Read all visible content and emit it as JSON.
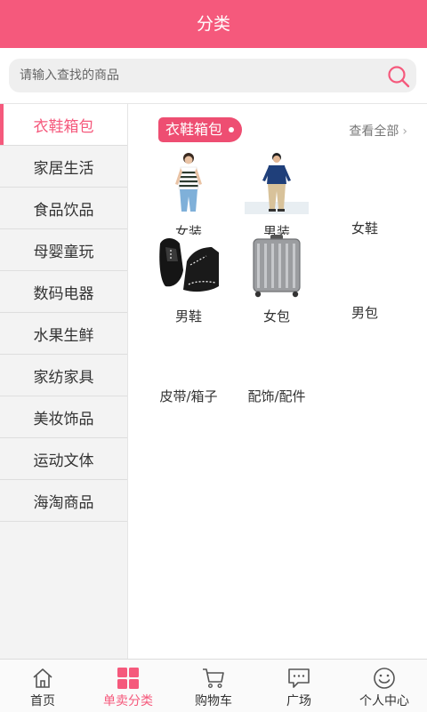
{
  "header": {
    "title": "分类"
  },
  "search": {
    "placeholder": "请输入查找的商品"
  },
  "sidebar": {
    "items": [
      {
        "label": "衣鞋箱包",
        "active": true
      },
      {
        "label": "家居生活"
      },
      {
        "label": "食品饮品"
      },
      {
        "label": "母婴童玩"
      },
      {
        "label": "数码电器"
      },
      {
        "label": "水果生鲜"
      },
      {
        "label": "家纺家具"
      },
      {
        "label": "美妆饰品"
      },
      {
        "label": "运动文体"
      },
      {
        "label": "海淘商品"
      }
    ]
  },
  "main": {
    "section_title": "衣鞋箱包",
    "view_all": "查看全部",
    "categories": [
      {
        "label": "女装",
        "icon": "womens-clothing-photo"
      },
      {
        "label": "男装",
        "icon": "mens-clothing-photo"
      },
      {
        "label": "女鞋",
        "icon": ""
      },
      {
        "label": "男鞋",
        "icon": "mens-shoes-photo"
      },
      {
        "label": "女包",
        "icon": "luggage-photo"
      },
      {
        "label": "男包",
        "icon": ""
      },
      {
        "label": "皮带/箱子",
        "icon": ""
      },
      {
        "label": "配饰/配件",
        "icon": ""
      }
    ]
  },
  "tabbar": {
    "tabs": [
      {
        "label": "首页",
        "icon": "home-icon"
      },
      {
        "label": "单卖分类",
        "icon": "grid-icon",
        "active": true
      },
      {
        "label": "购物车",
        "icon": "cart-icon"
      },
      {
        "label": "广场",
        "icon": "chat-icon"
      },
      {
        "label": "个人中心",
        "icon": "smiley-icon"
      }
    ]
  },
  "colors": {
    "accent": "#f5597c",
    "tag": "#ee4e72"
  }
}
